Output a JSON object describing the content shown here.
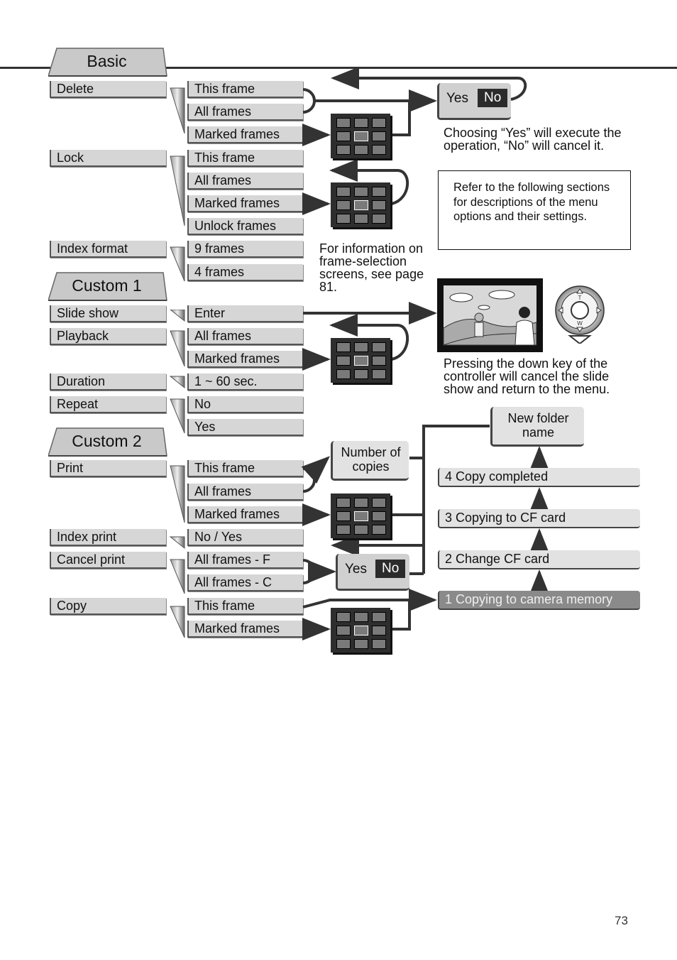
{
  "tabs": {
    "basic": "Basic",
    "custom1": "Custom 1",
    "custom2": "Custom 2"
  },
  "menu": {
    "basic": [
      {
        "label": "Delete",
        "options": [
          "This frame",
          "All frames",
          "Marked frames"
        ]
      },
      {
        "label": "Lock",
        "options": [
          "This frame",
          "All frames",
          "Marked frames",
          "Unlock frames"
        ]
      },
      {
        "label": "Index format",
        "options": [
          "9 frames",
          "4 frames"
        ]
      }
    ],
    "custom1": [
      {
        "label": "Slide show",
        "options": [
          "Enter"
        ]
      },
      {
        "label": "Playback",
        "options": [
          "All frames",
          "Marked frames"
        ]
      },
      {
        "label": "Duration",
        "options": [
          "1 ~ 60 sec."
        ]
      },
      {
        "label": "Repeat",
        "options": [
          "No",
          "Yes"
        ]
      }
    ],
    "custom2": [
      {
        "label": "Print",
        "options": [
          "This frame",
          "All frames",
          "Marked frames"
        ]
      },
      {
        "label": "Index print",
        "options": [
          "No / Yes"
        ]
      },
      {
        "label": "Cancel print",
        "options": [
          "All frames - F",
          "All frames - C"
        ]
      },
      {
        "label": "Copy",
        "options": [
          "This frame",
          "Marked frames"
        ]
      }
    ]
  },
  "confirm": {
    "yes": "Yes",
    "no": "No"
  },
  "captions": {
    "yes_no": "Choosing “Yes” will execute the operation, “No” will cancel it.",
    "note": "Refer to the following sections for descriptions of the menu options and their settings.",
    "frame_selection": "For information on frame-selection screens, see page 81.",
    "slideshow": "Pressing the down key of the controller will cancel the slide show and return to the menu."
  },
  "copies_box": "Number of copies",
  "new_folder_box": "New folder name",
  "copy_steps": [
    "4 Copy completed",
    "3 Copying to CF card",
    "2 Change CF card",
    "1 Copying to camera memory"
  ],
  "controller": {
    "top": "T",
    "bottom": "W"
  },
  "page_number": "73"
}
